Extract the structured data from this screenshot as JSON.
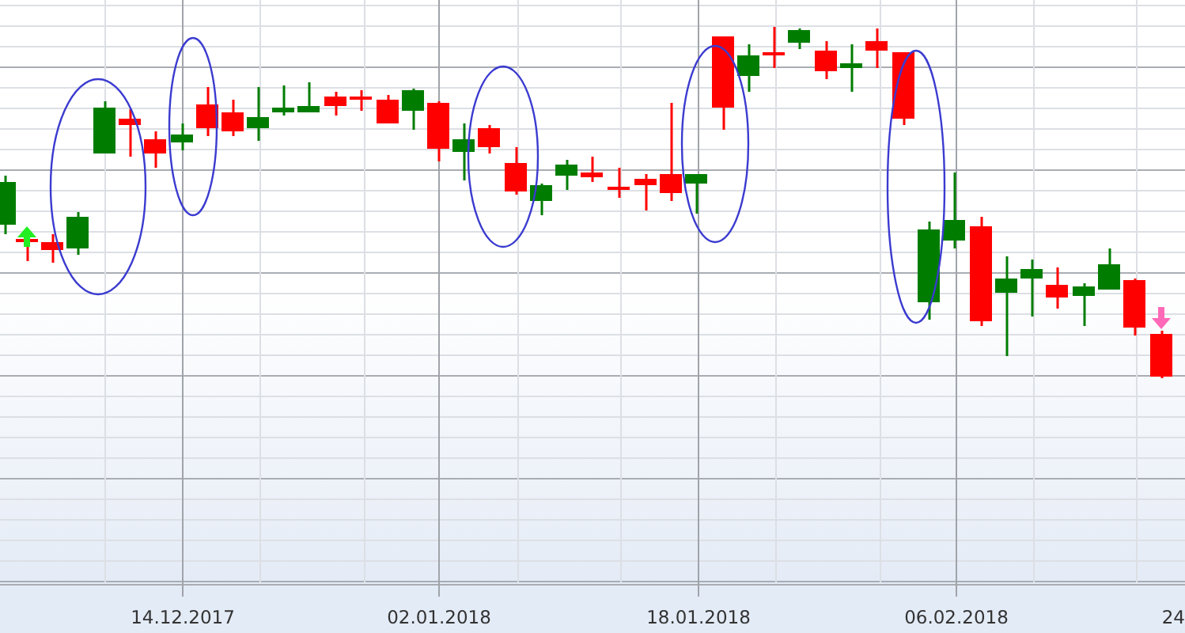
{
  "chart": {
    "x_axis_labels": [
      "14.12.2017",
      "02.01.2018",
      "18.01.2018",
      "06.02.2018",
      "24"
    ]
  }
}
